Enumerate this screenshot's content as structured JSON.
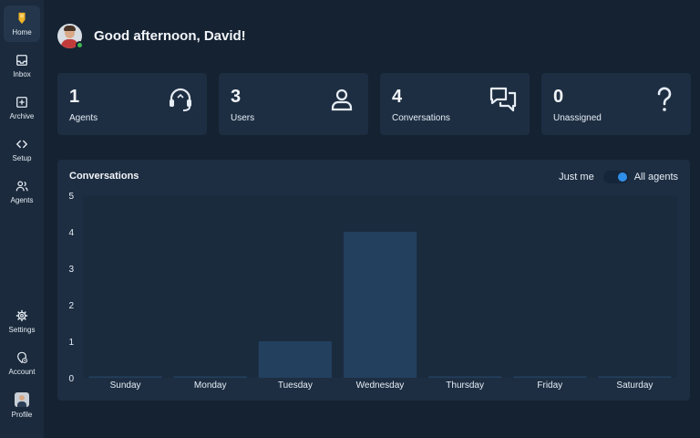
{
  "sidebar": {
    "items": [
      {
        "label": "Home",
        "icon": "home-icon",
        "active": true
      },
      {
        "label": "Inbox",
        "icon": "inbox-icon"
      },
      {
        "label": "Archive",
        "icon": "archive-icon"
      },
      {
        "label": "Setup",
        "icon": "code-icon"
      },
      {
        "label": "Agents",
        "icon": "agents-icon"
      }
    ],
    "bottom_items": [
      {
        "label": "Settings",
        "icon": "gear-icon"
      },
      {
        "label": "Account",
        "icon": "account-icon"
      },
      {
        "label": "Profile",
        "icon": "profile-avatar"
      }
    ]
  },
  "header": {
    "greeting": "Good afternoon, David!",
    "status": "online"
  },
  "stats": [
    {
      "value": "1",
      "label": "Agents",
      "icon": "headset-icon"
    },
    {
      "value": "3",
      "label": "Users",
      "icon": "user-icon"
    },
    {
      "value": "4",
      "label": "Conversations",
      "icon": "chat-bubbles-icon"
    },
    {
      "value": "0",
      "label": "Unassigned",
      "icon": "question-mark-icon"
    }
  ],
  "chart": {
    "title": "Conversations",
    "toggle": {
      "left_label": "Just me",
      "right_label": "All agents",
      "selected": "All agents"
    }
  },
  "colors": {
    "background": "#152232",
    "sidebar": "#1b2a3c",
    "card": "#1e2e42",
    "bar": "#23405f",
    "accent": "#2f8fe8",
    "online": "#3fb950"
  },
  "chart_data": {
    "type": "bar",
    "title": "Conversations",
    "categories": [
      "Sunday",
      "Monday",
      "Tuesday",
      "Wednesday",
      "Thursday",
      "Friday",
      "Saturday"
    ],
    "values": [
      0,
      0,
      1,
      4,
      0,
      0,
      0
    ],
    "y_ticks": [
      0,
      1,
      2,
      3,
      4,
      5
    ],
    "ylim": [
      0,
      5
    ],
    "grid": false,
    "legend": "none"
  }
}
